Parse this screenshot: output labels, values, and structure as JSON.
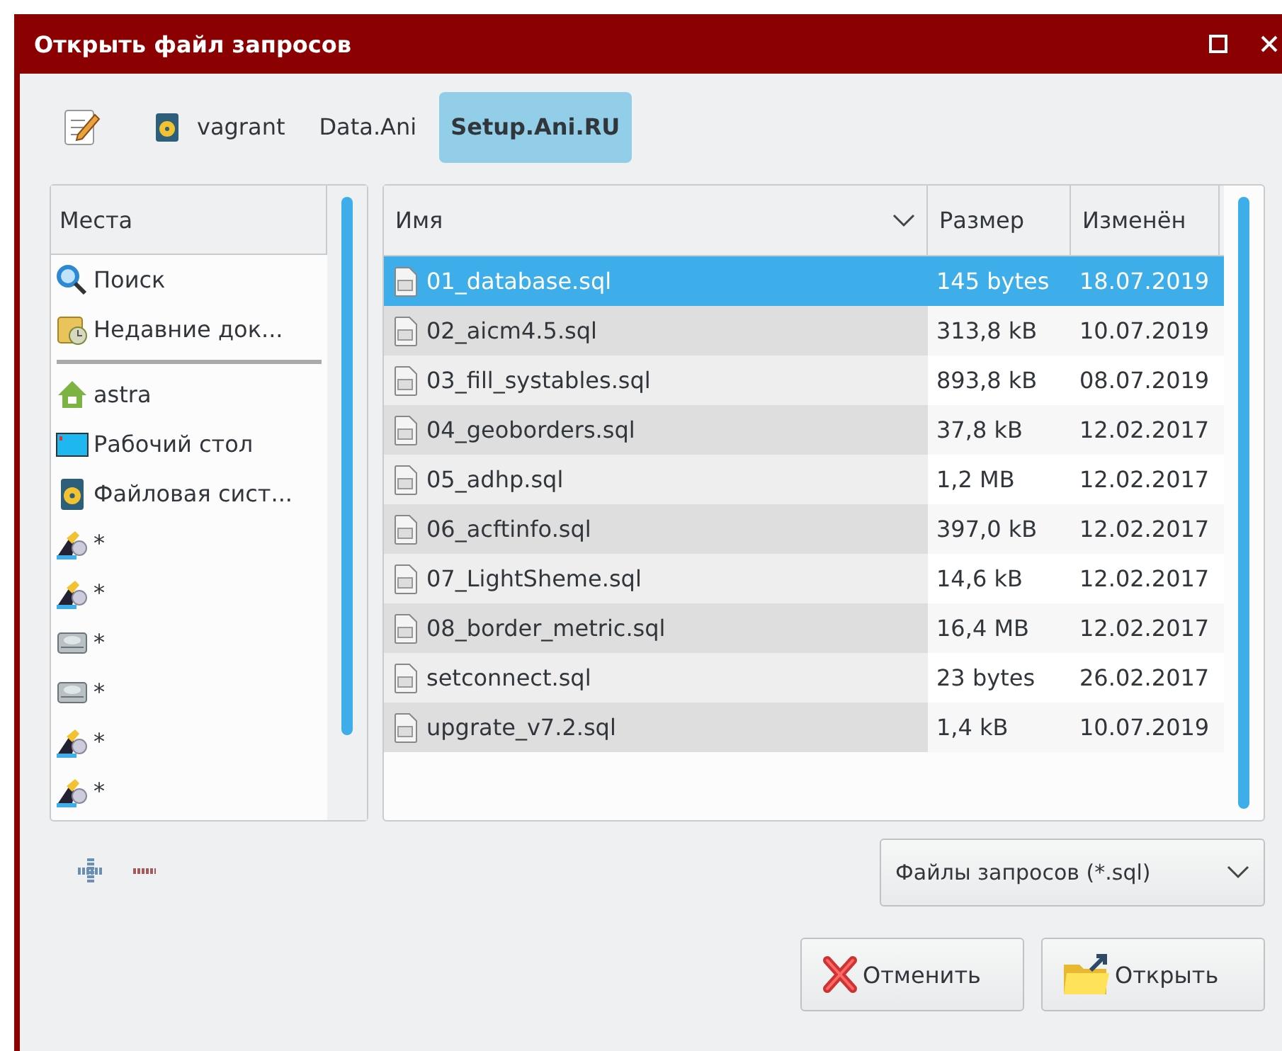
{
  "window": {
    "title": "Открыть файл запросов"
  },
  "breadcrumbs": [
    {
      "kind": "drive",
      "label": "vagrant",
      "selected": false
    },
    {
      "kind": "folder",
      "label": "Data.Ani",
      "selected": false
    },
    {
      "kind": "folder",
      "label": "Setup.Ani.RU",
      "selected": true
    }
  ],
  "places": {
    "header": "Места",
    "groups": [
      [
        {
          "kind": "search",
          "label": "Поиск"
        },
        {
          "kind": "recent",
          "label": "Недавние док..."
        }
      ],
      [
        {
          "kind": "home",
          "label": "astra"
        },
        {
          "kind": "desktop",
          "label": "Рабочий стол"
        },
        {
          "kind": "drive",
          "label": "Файловая сист..."
        },
        {
          "kind": "network",
          "label": "*"
        },
        {
          "kind": "network",
          "label": "*"
        },
        {
          "kind": "disk",
          "label": "*"
        },
        {
          "kind": "disk",
          "label": "*"
        },
        {
          "kind": "network",
          "label": "*"
        },
        {
          "kind": "network",
          "label": "*"
        }
      ]
    ]
  },
  "files": {
    "columns": [
      "Имя",
      "Размер",
      "Изменён"
    ],
    "rows": [
      {
        "name": "01_database.sql",
        "size": "145 bytes",
        "modified": "18.07.2019",
        "selected": true
      },
      {
        "name": "02_aicm4.5.sql",
        "size": "313,8 kB",
        "modified": "10.07.2019",
        "selected": false
      },
      {
        "name": "03_fill_systables.sql",
        "size": "893,8 kB",
        "modified": "08.07.2019",
        "selected": false
      },
      {
        "name": "04_geoborders.sql",
        "size": "37,8 kB",
        "modified": "12.02.2017",
        "selected": false
      },
      {
        "name": "05_adhp.sql",
        "size": "1,2 MB",
        "modified": "12.02.2017",
        "selected": false
      },
      {
        "name": "06_acftinfo.sql",
        "size": "397,0 kB",
        "modified": "12.02.2017",
        "selected": false
      },
      {
        "name": "07_LightSheme.sql",
        "size": "14,6 kB",
        "modified": "12.02.2017",
        "selected": false
      },
      {
        "name": "08_border_metric.sql",
        "size": "16,4 MB",
        "modified": "12.02.2017",
        "selected": false
      },
      {
        "name": "setconnect.sql",
        "size": "23 bytes",
        "modified": "26.02.2017",
        "selected": false
      },
      {
        "name": "upgrate_v7.2.sql",
        "size": "1,4 kB",
        "modified": "10.07.2019",
        "selected": false
      }
    ]
  },
  "filter": {
    "value": "Файлы запросов (*.sql)"
  },
  "buttons": [
    {
      "kind": "cancel",
      "label": "Отменить"
    },
    {
      "kind": "open",
      "label": "Открыть"
    }
  ]
}
